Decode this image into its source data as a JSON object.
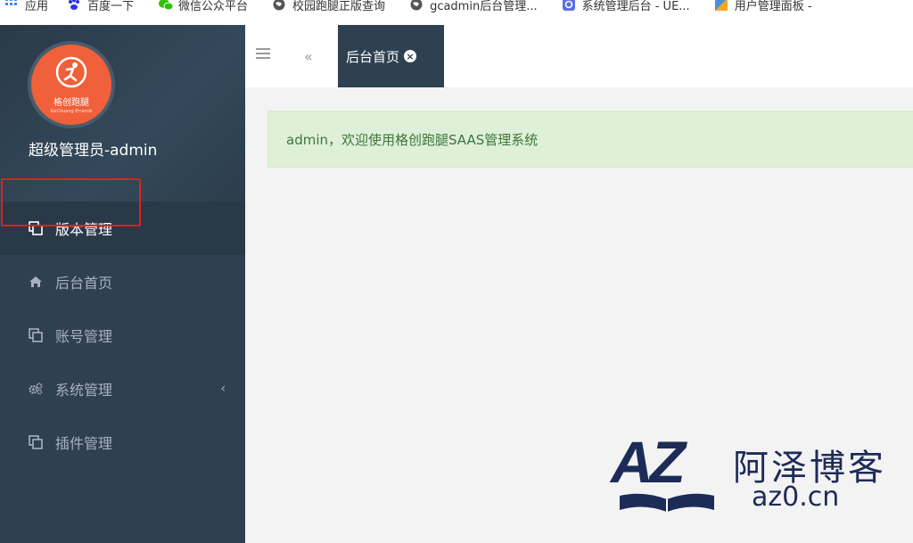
{
  "bookmarks": [
    {
      "label": "应用",
      "icon": "apps-grid-icon",
      "color": "#4285f4"
    },
    {
      "label": "百度一下",
      "icon": "baidu-paw-icon",
      "color": "#2932e1"
    },
    {
      "label": "微信公众平台",
      "icon": "wechat-icon",
      "color": "#2dc100"
    },
    {
      "label": "校园跑腿正版查询",
      "icon": "globe-icon",
      "color": "#555555"
    },
    {
      "label": "gcadmin后台管理...",
      "icon": "globe-icon",
      "color": "#555555"
    },
    {
      "label": "系统管理后台 - UE...",
      "icon": "ue-logo-icon",
      "color": "#5b6ee1"
    },
    {
      "label": "用户管理面板 -",
      "icon": "panel-icon",
      "color": "#f5a623"
    }
  ],
  "sidebar": {
    "user_name": "超级管理员-admin",
    "avatar": {
      "brand": "格创跑腿",
      "sub": "GeChuang Errands",
      "color": "#f0603a"
    },
    "items": [
      {
        "label": "版本管理",
        "icon": "copy-icon",
        "active": true
      },
      {
        "label": "后台首页",
        "icon": "home-icon",
        "active": false
      },
      {
        "label": "账号管理",
        "icon": "copy-icon",
        "active": false
      },
      {
        "label": "系统管理",
        "icon": "gears-icon",
        "active": false,
        "chevron": "‹"
      },
      {
        "label": "插件管理",
        "icon": "copy-icon",
        "active": false
      }
    ]
  },
  "topbar": {
    "active_tab": "后台首页",
    "close_glyph": "×",
    "prev_glyph": "«"
  },
  "main": {
    "welcome": "admin，欢迎使用格创跑腿SAAS管理系统"
  },
  "watermark": {
    "logo": "AZ",
    "name": "阿泽博客",
    "url": "az0.cn"
  },
  "colors": {
    "sidebar_bg": "#2f4050",
    "alert_bg": "#dff0d8",
    "alert_text": "#3c763d",
    "highlight": "#e02020"
  }
}
